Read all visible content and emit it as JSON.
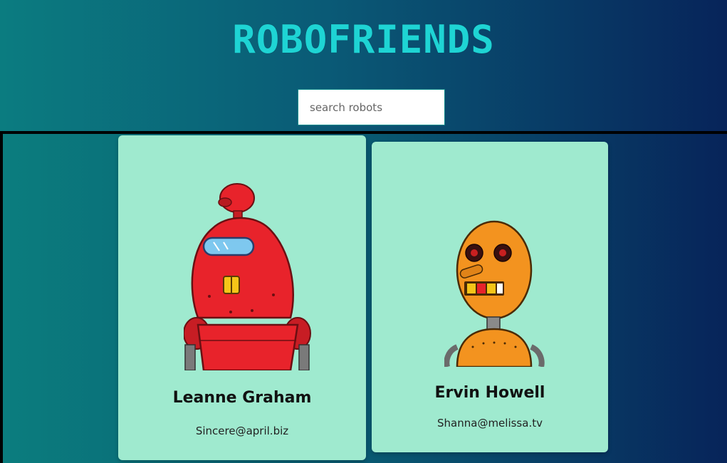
{
  "header": {
    "title": "ROBOFRIENDS"
  },
  "search": {
    "placeholder": "search robots",
    "value": ""
  },
  "robots": [
    {
      "name": "Leanne Graham",
      "email": "Sincere@april.biz",
      "color": "#e8232b"
    },
    {
      "name": "Ervin Howell",
      "email": "Shanna@melissa.tv",
      "color": "#f3931f"
    }
  ],
  "colors": {
    "title": "#1ed4d4",
    "card_background": "#9feacf",
    "background_left": "#0b7c80",
    "background_right": "#07245a"
  }
}
